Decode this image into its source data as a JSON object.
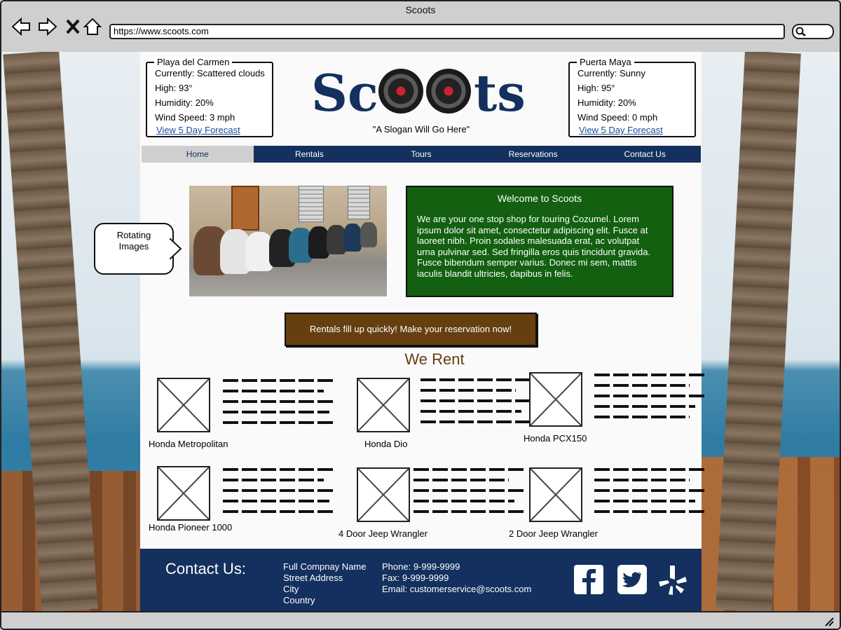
{
  "browser": {
    "title": "Scoots",
    "url": "https://www.scoots.com"
  },
  "weather_left": {
    "location": "Playa del Carmen",
    "currently": "Currently: Scattered clouds",
    "high": "High: 93°",
    "humidity": "Humidity: 20%",
    "wind": "Wind Speed: 3 mph",
    "forecast_link": "View 5 Day Forecast"
  },
  "weather_right": {
    "location": "Puerta Maya",
    "currently": "Currently: Sunny",
    "high": "High: 95°",
    "humidity": "Humidity: 20%",
    "wind": "Wind Speed: 0 mph",
    "forecast_link": "View 5 Day Forecast"
  },
  "logo": {
    "part1": "Sc",
    "part2": "ts"
  },
  "slogan": "\"A Slogan Will Go Here\"",
  "nav": [
    "Home",
    "Rentals",
    "Tours",
    "Reservations",
    "Contact Us"
  ],
  "callout": "Rotating Images",
  "welcome": {
    "title": "Welcome to Scoots",
    "body": "We are your one stop shop for touring Cozumel. Lorem ipsum dolor sit amet, consectetur adipiscing elit. Fusce at laoreet nibh. Proin sodales malesuada erat, ac volutpat urna pulvinar sed. Sed fringilla eros quis tincidunt gravida. Fusce bibendum semper varius. Donec mi sem, mattis iaculis blandit ultricies, dapibus in felis."
  },
  "cta": "Rentals fill up quickly! Make your reservation now!",
  "we_rent": "We Rent",
  "rentals": [
    {
      "name": "Honda Metropolitan"
    },
    {
      "name": "Honda Dio"
    },
    {
      "name": "Honda PCX150"
    },
    {
      "name": "Honda Pioneer 1000"
    },
    {
      "name": "4 Door Jeep Wrangler"
    },
    {
      "name": "2 Door Jeep Wrangler"
    }
  ],
  "footer": {
    "title": "Contact Us:",
    "company": "Full Compnay Name",
    "street": "Street Address",
    "city": "City",
    "country": "Country",
    "phone": "Phone: 9-999-9999",
    "fax": "Fax: 9-999-9999",
    "email": "Email: customerservice@scoots.com"
  },
  "social_icons": [
    "facebook-icon",
    "twitter-icon",
    "yelp-icon"
  ],
  "colors": {
    "navy": "#13305e",
    "green": "#126010",
    "brown": "#653f10"
  }
}
